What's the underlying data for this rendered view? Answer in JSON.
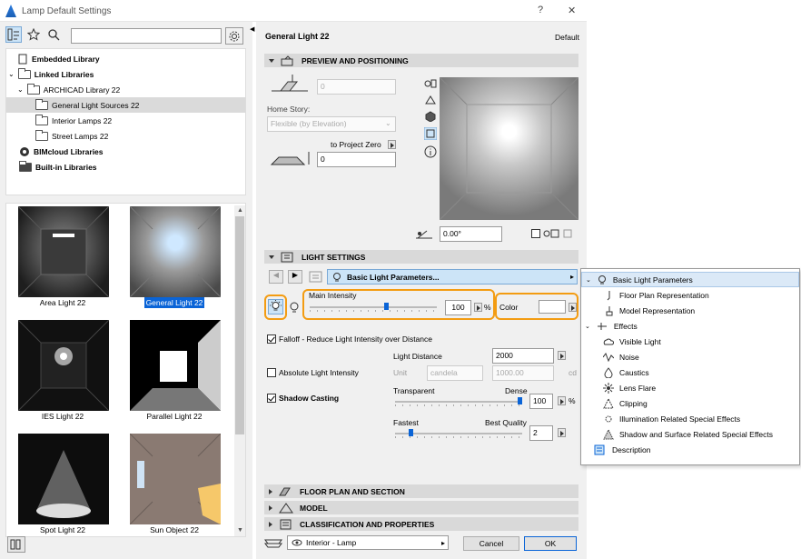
{
  "window": {
    "title": "Lamp Default Settings",
    "help": "?",
    "close": "✕"
  },
  "library": {
    "tree": [
      {
        "label": "Embedded Library"
      },
      {
        "label": "Linked Libraries"
      },
      {
        "label": "ARCHICAD Library 22"
      },
      {
        "label": "General Light Sources 22"
      },
      {
        "label": "Interior Lamps 22"
      },
      {
        "label": "Street Lamps 22"
      },
      {
        "label": "BIMcloud Libraries"
      },
      {
        "label": "Built-in Libraries"
      }
    ],
    "gallery": [
      {
        "label": "Area Light 22"
      },
      {
        "label": "General Light 22"
      },
      {
        "label": "IES Light 22"
      },
      {
        "label": "Parallel Light 22"
      },
      {
        "label": "Spot Light 22"
      },
      {
        "label": "Sun Object 22"
      }
    ]
  },
  "header": {
    "object_name": "General Light 22",
    "default_label": "Default"
  },
  "preview": {
    "section_title": "PREVIEW AND POSITIONING",
    "elevation_value": "0",
    "home_story_label": "Home Story:",
    "home_story_value": "Flexible (by Elevation)",
    "to_project_zero": "to Project Zero",
    "offset_value": "0",
    "angle_value": "0.00°"
  },
  "light": {
    "section_title": "LIGHT SETTINGS",
    "page_select": "Basic Light Parameters...",
    "main_intensity_label": "Main Intensity",
    "main_intensity_value": "100",
    "main_intensity_pct": 60,
    "percent": "%",
    "color_label": "Color",
    "falloff_label": "Falloff - Reduce Light Intensity over Distance",
    "falloff_checked": true,
    "light_distance_label": "Light Distance",
    "light_distance_value": "2000",
    "absolute_label": "Absolute Light Intensity",
    "absolute_checked": false,
    "unit_label": "Unit",
    "unit_value": "candela",
    "unit_amount": "1000.00",
    "unit_suffix": "cd",
    "shadow_label": "Shadow Casting",
    "shadow_checked": true,
    "transparent_label": "Transparent",
    "dense_label": "Dense",
    "shadow_density_value": "100",
    "shadow_density_pct": 100,
    "fastest_label": "Fastest",
    "best_quality_label": "Best Quality",
    "quality_value": "2",
    "quality_pct": 12
  },
  "sections": [
    {
      "title": "FLOOR PLAN AND SECTION"
    },
    {
      "title": "MODEL"
    },
    {
      "title": "CLASSIFICATION AND PROPERTIES"
    }
  ],
  "dropdown": {
    "items": [
      {
        "label": "Basic Light Parameters"
      },
      {
        "label": "Floor Plan Representation"
      },
      {
        "label": "Model Representation"
      },
      {
        "label": "Effects"
      },
      {
        "label": "Visible Light"
      },
      {
        "label": "Noise"
      },
      {
        "label": "Caustics"
      },
      {
        "label": "Lens Flare"
      },
      {
        "label": "Clipping"
      },
      {
        "label": "Illumination Related Special Effects"
      },
      {
        "label": "Shadow and Surface Related Special Effects"
      },
      {
        "label": "Description"
      }
    ]
  },
  "footer": {
    "layer": "Interior - Lamp",
    "cancel": "Cancel",
    "ok": "OK"
  },
  "colors": {
    "accent": "#0a64d7",
    "highlight": "#f39c12",
    "section_bg": "#d9d9d9"
  }
}
